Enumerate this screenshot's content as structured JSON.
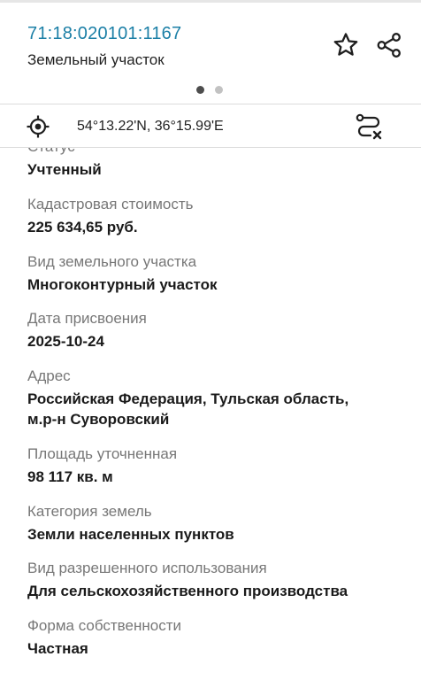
{
  "header": {
    "cadastral_number": "71:18:020101:1167",
    "object_type": "Земельный участок",
    "pager": {
      "total": 2,
      "active": 1
    }
  },
  "icons": {
    "favorite": "star-icon",
    "share": "share-icon",
    "locate": "crosshair-icon",
    "route": "route-clear-icon"
  },
  "coords": {
    "text": "54°13.22'N, 36°15.99'E"
  },
  "fields": {
    "status": {
      "label": "Статус",
      "value": "Учтенный"
    },
    "cadastral_value": {
      "label": "Кадастровая стоимость",
      "value": "225 634,65 руб."
    },
    "parcel_kind": {
      "label": "Вид земельного участка",
      "value": "Многоконтурный участок"
    },
    "assigned_date": {
      "label": "Дата присвоения",
      "value": "2025-10-24"
    },
    "address": {
      "label": "Адрес",
      "value_line1": "Российская Федерация, Тульская область,",
      "value_line2": "м.р-н Суворовский"
    },
    "area": {
      "label": "Площадь уточненная",
      "value": "98 117 кв. м"
    },
    "land_category": {
      "label": "Категория земель",
      "value": "Земли населенных пунктов"
    },
    "permitted_use": {
      "label": "Вид разрешенного использования",
      "value": "Для сельскохозяйственного производства"
    },
    "ownership": {
      "label": "Форма собственности",
      "value": "Частная"
    }
  },
  "colors": {
    "accent": "#1b7fa6",
    "label": "#777777",
    "value": "#1a1a1a",
    "divider": "#dcdcdc"
  }
}
